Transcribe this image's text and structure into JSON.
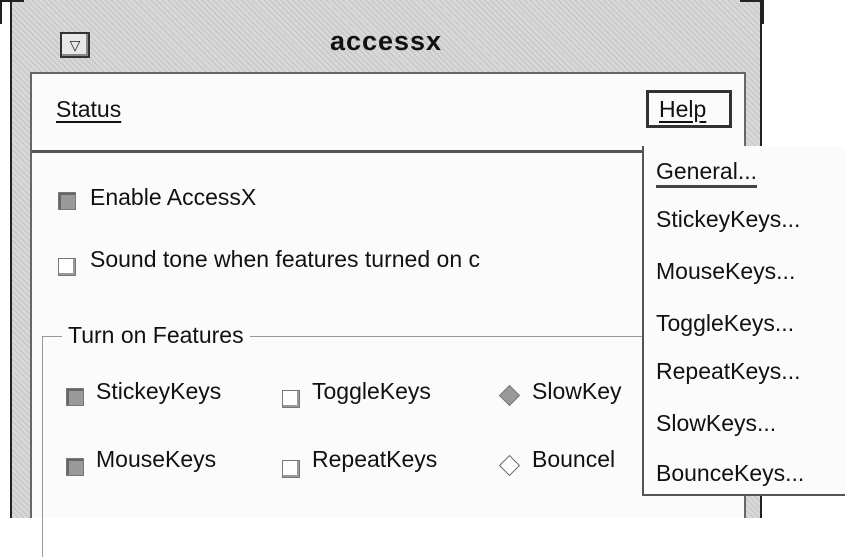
{
  "window": {
    "title": "accessx",
    "menu_button_glyph": "▽"
  },
  "menubar": {
    "status_label": "Status",
    "help_label": "Help"
  },
  "options": {
    "enable_accessx": {
      "label": "Enable AccessX",
      "checked": true
    },
    "sound_tone": {
      "label": "Sound tone when features turned on c",
      "checked": false
    }
  },
  "features": {
    "group_title": "Turn on Features",
    "row1": [
      {
        "label": "StickeyKeys",
        "checked": true,
        "kind": "check"
      },
      {
        "label": "ToggleKeys",
        "checked": false,
        "kind": "check"
      },
      {
        "label": "SlowKey",
        "checked": true,
        "kind": "diamond"
      }
    ],
    "row2": [
      {
        "label": "MouseKeys",
        "checked": true,
        "kind": "check"
      },
      {
        "label": "RepeatKeys",
        "checked": false,
        "kind": "check"
      },
      {
        "label": "Bouncel",
        "checked": false,
        "kind": "diamond"
      }
    ]
  },
  "help_menu": {
    "items": [
      "General...",
      "StickeyKeys...",
      "MouseKeys...",
      "ToggleKeys...",
      "RepeatKeys...",
      "SlowKeys...",
      "BounceKeys..."
    ]
  },
  "icons": {
    "window_menu": "window-menu-icon",
    "checkbox": "checkbox-icon",
    "radio_diamond": "diamond-toggle-icon"
  }
}
